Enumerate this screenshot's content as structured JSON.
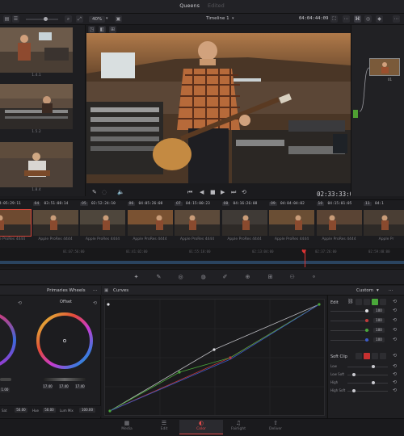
{
  "title_bar": {
    "project": "Queens",
    "status": "Edited"
  },
  "viewer_bar": {
    "zoom": "40%",
    "timeline_name": "Timeline 1",
    "timecode": "04:04:44:09"
  },
  "gallery": {
    "stills": [
      {
        "label": "1.4.1"
      },
      {
        "label": "1.5.2"
      },
      {
        "label": "1.8.4"
      }
    ]
  },
  "viewer": {
    "timecode": "02:33:33:06"
  },
  "clips": [
    {
      "num": "03",
      "tc": "04:05:29:11",
      "label": "Apple ProRes 4444"
    },
    {
      "num": "04",
      "tc": "03:51:08:14",
      "label": "Apple ProRes 4444"
    },
    {
      "num": "05",
      "tc": "02:52:24:10",
      "label": "Apple ProRes 4444"
    },
    {
      "num": "06",
      "tc": "04:05:26:08",
      "label": "Apple ProRes 4444"
    },
    {
      "num": "07",
      "tc": "04:15:00:23",
      "label": "Apple ProRes 4444"
    },
    {
      "num": "08",
      "tc": "04:16:26:08",
      "label": "Apple ProRes 4444"
    },
    {
      "num": "09",
      "tc": "04:04:04:02",
      "label": "Apple ProRes 4444"
    },
    {
      "num": "10",
      "tc": "04:15:01:05",
      "label": "Apple ProRes 4444"
    },
    {
      "num": "11",
      "tc": "04:1",
      "label": "Apple Pr"
    }
  ],
  "ruler": [
    "01:07:56:00",
    "01:41:02:00",
    "01:55:18:00",
    "02:13:04:00",
    "02:37:26:00",
    "02:59:48:00"
  ],
  "primaries": {
    "title": "Primaries Wheels",
    "offset_label": "Offset",
    "offset_values": [
      "17.40",
      "17.40",
      "17.40"
    ],
    "left_values": [
      "1.00",
      "1.00"
    ],
    "footer_left_label": "Sat",
    "footer_left_value": "50.00",
    "footer_mid_label": "Hue",
    "footer_mid_value": "50.00",
    "footer_right_label": "Lum Mix",
    "footer_right_value": "100.00"
  },
  "curves": {
    "title": "Curves",
    "mode": "Custom"
  },
  "edit_panel": {
    "title": "Edit",
    "values": [
      "100",
      "100",
      "100",
      "100"
    ],
    "soft_clip_title": "Soft Clip",
    "soft_clip_rows": [
      "Low",
      "Low Soft",
      "High",
      "High Soft"
    ]
  },
  "pages": [
    {
      "label": "Media",
      "icon": "▦"
    },
    {
      "label": "Edit",
      "icon": "☰"
    },
    {
      "label": "Color",
      "icon": "◐"
    },
    {
      "label": "Fairlight",
      "icon": "♫"
    },
    {
      "label": "Deliver",
      "icon": "⇧"
    }
  ],
  "active_page": "Color"
}
